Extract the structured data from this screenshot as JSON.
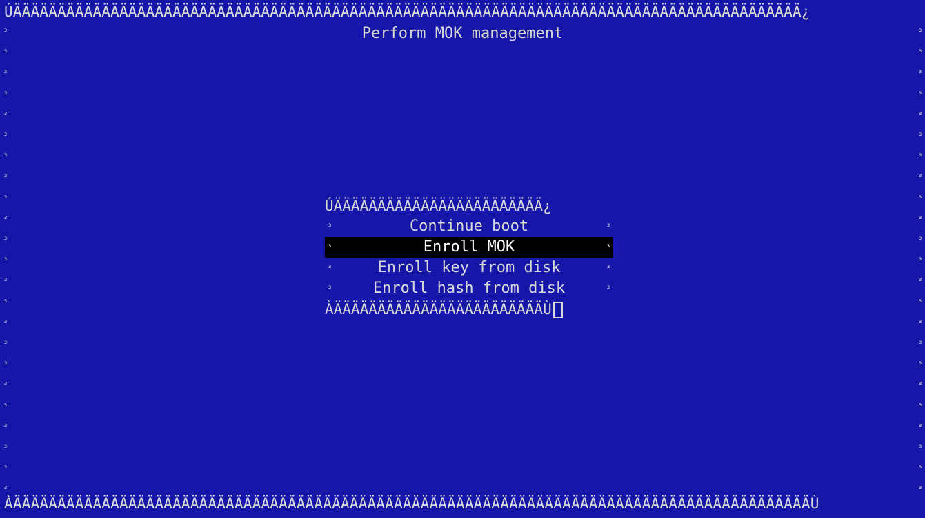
{
  "screen": {
    "title": "Perform MOK management",
    "frame_top": "ÚÄÄÄÄÄÄÄÄÄÄÄÄÄÄÄÄÄÄÄÄÄÄÄÄÄÄÄÄÄÄÄÄÄÄÄÄÄÄÄÄÄÄÄÄÄÄÄÄÄÄÄÄÄÄÄÄÄÄÄÄÄÄÄÄÄÄÄÄÄÄÄÄÄÄÄÄÄÄÄÄÄÄÄÄÄÄÄÄÄ¿",
    "frame_bottom": "ÀÄÄÄÄÄÄÄÄÄÄÄÄÄÄÄÄÄÄÄÄÄÄÄÄÄÄÄÄÄÄÄÄÄÄÄÄÄÄÄÄÄÄÄÄÄÄÄÄÄÄÄÄÄÄÄÄÄÄÄÄÄÄÄÄÄÄÄÄÄÄÄÄÄÄÄÄÄÄÄÄÄÄÄÄÄÄÄÄÄÄÙ",
    "frame_side": "³"
  },
  "menu": {
    "border_top": "ÚÄÄÄÄÄÄÄÄÄÄÄÄÄÄÄÄÄÄÄÄÄÄÄÄ¿",
    "border_bottom": "ÀÄÄÄÄÄÄÄÄÄÄÄÄÄÄÄÄÄÄÄÄÄÄÄÄÙ",
    "side": "³",
    "selected_index": 1,
    "items": [
      {
        "label": "Continue boot"
      },
      {
        "label": "Enroll MOK"
      },
      {
        "label": "Enroll key from disk"
      },
      {
        "label": "Enroll hash from disk"
      }
    ]
  },
  "colors": {
    "background": "#1616a8",
    "text": "#d8d8d8",
    "highlight_bg": "#000000",
    "highlight_text": "#ffffff"
  }
}
